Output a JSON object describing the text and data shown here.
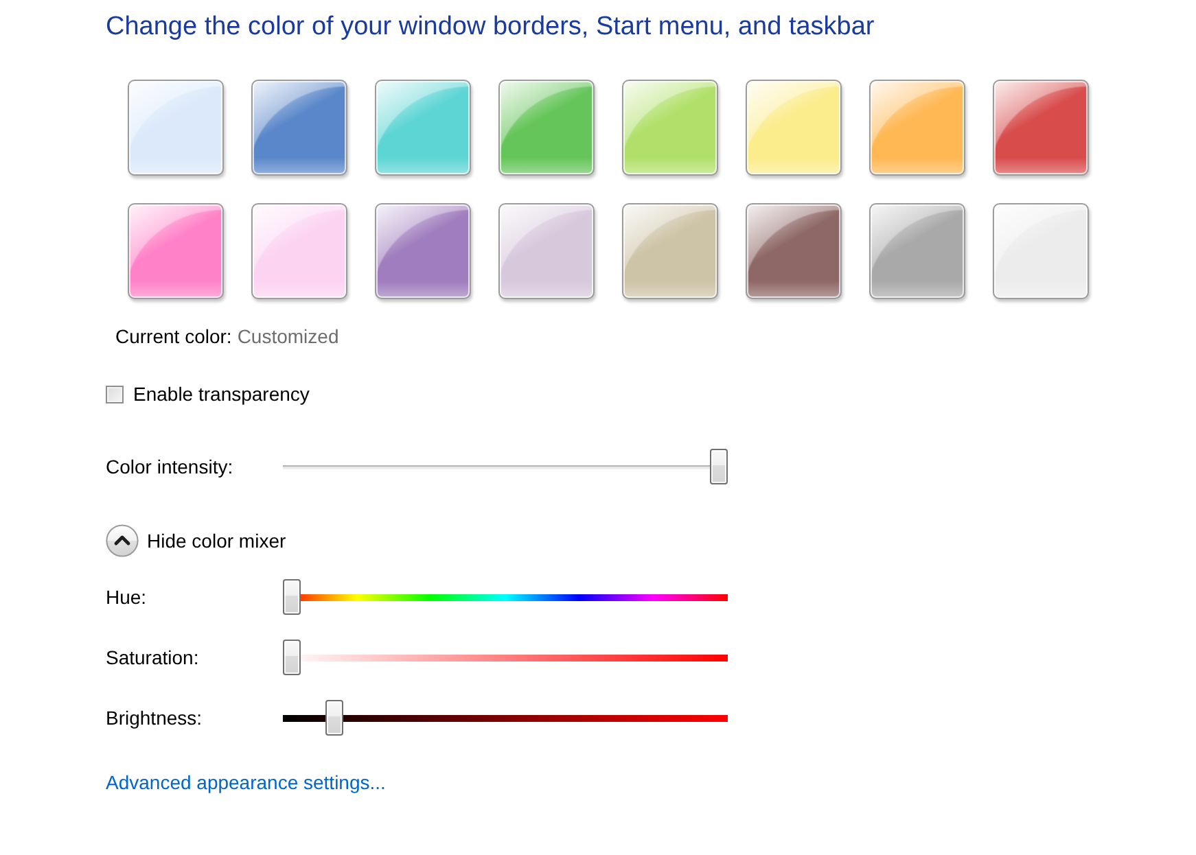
{
  "title": "Change the color of your window borders, Start menu, and taskbar",
  "swatches": [
    {
      "color": "#dbe9fb"
    },
    {
      "color": "#5a87c9"
    },
    {
      "color": "#5dd5d4"
    },
    {
      "color": "#66c55a"
    },
    {
      "color": "#b1e06a"
    },
    {
      "color": "#fbec8c"
    },
    {
      "color": "#ffb854"
    },
    {
      "color": "#d84c4c"
    },
    {
      "color": "#ff82c8"
    },
    {
      "color": "#fcd4f2"
    },
    {
      "color": "#a07dbe"
    },
    {
      "color": "#d8c8dc"
    },
    {
      "color": "#cdc3a6"
    },
    {
      "color": "#8e6866"
    },
    {
      "color": "#a9a9a9"
    },
    {
      "color": "#ececec"
    }
  ],
  "current_color": {
    "label": "Current color:",
    "value": "Customized"
  },
  "transparency": {
    "label": "Enable transparency",
    "checked": false
  },
  "color_intensity": {
    "label": "Color intensity:",
    "level": 1
  },
  "color_mixer": {
    "toggle_label": "Hide color mixer",
    "expanded": true,
    "sliders": [
      {
        "kind": "hue",
        "label": "Hue:",
        "level": 0
      },
      {
        "kind": "saturation",
        "label": "Saturation:",
        "level": 0
      },
      {
        "kind": "brightness",
        "label": "Brightness:",
        "level": 0.1
      }
    ]
  },
  "advanced_link": "Advanced appearance settings..."
}
